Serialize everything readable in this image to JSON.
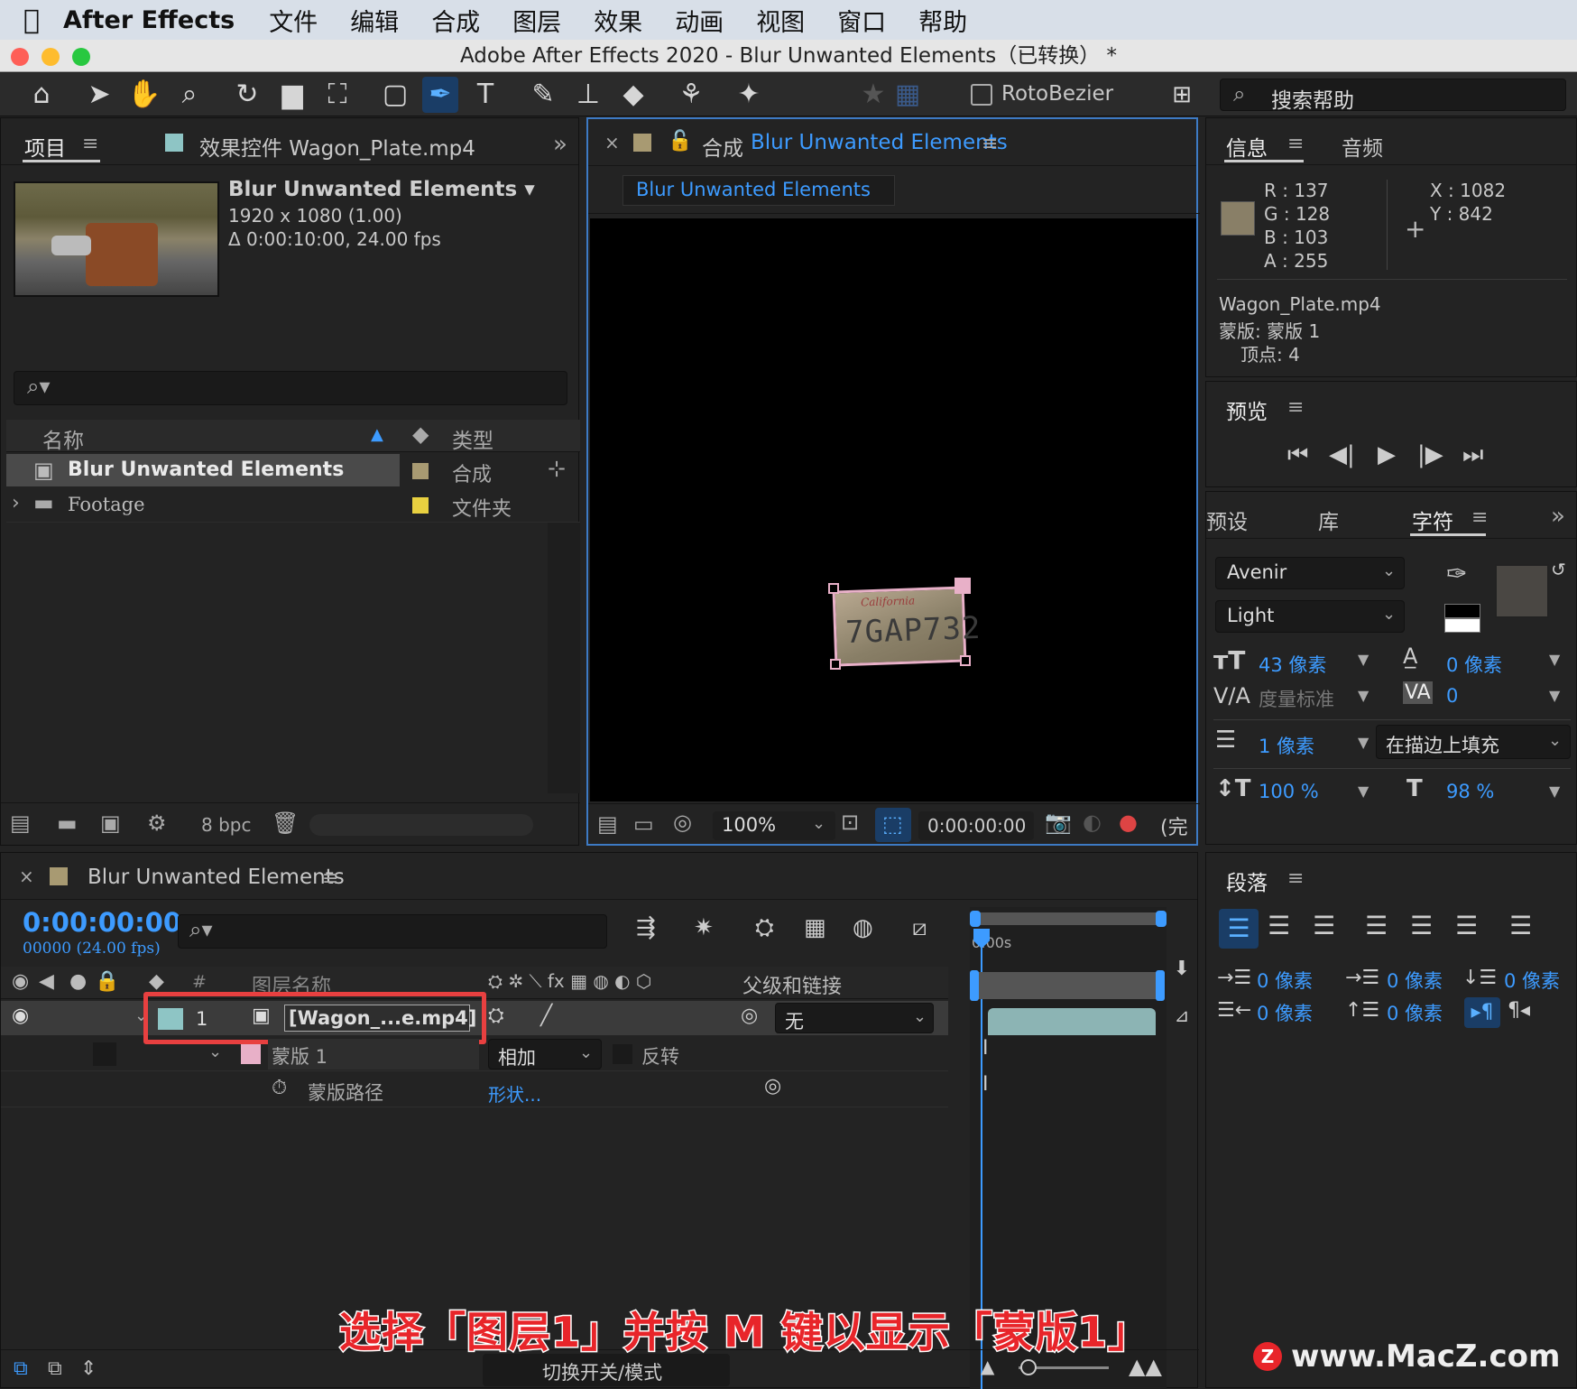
{
  "menubar": {
    "app_name": "After Effects",
    "items": [
      "文件",
      "编辑",
      "合成",
      "图层",
      "效果",
      "动画",
      "视图",
      "窗口",
      "帮助"
    ]
  },
  "window": {
    "title": "Adobe After Effects 2020 - Blur Unwanted Elements（已转换） *"
  },
  "toolbar": {
    "roto_label": "RotoBezier",
    "search_help": "搜索帮助"
  },
  "project_panel": {
    "tab_project": "项目",
    "tab_effects": "效果控件 Wagon_Plate.mp4",
    "comp_name": "Blur Unwanted Elements",
    "comp_size": "1920 x 1080 (1.00)",
    "comp_duration": "Δ 0:00:10:00, 24.00 fps",
    "col_name": "名称",
    "col_type": "类型",
    "items": [
      {
        "name": "Blur Unwanted Elements",
        "type": "合成",
        "color": "#a89a72"
      },
      {
        "name": "Footage",
        "type": "文件夹",
        "color": "#e8d040"
      }
    ],
    "bpc": "8 bpc"
  },
  "comp_panel": {
    "tab_prefix": "合成",
    "tab_name": "Blur Unwanted Elements",
    "subtab": "Blur Unwanted Elements",
    "zoom": "100%",
    "timecode": "0:00:00:00",
    "quality_fragment": "(完",
    "plate_text": "7GAP732",
    "plate_state": "California"
  },
  "info_panel": {
    "tab_info": "信息",
    "tab_audio": "音频",
    "r": "R :  137",
    "g": "G :  128",
    "b": "B :  103",
    "a": "A :  255",
    "x": "X :  1082",
    "y": "Y :  842",
    "swatch": "#897f67",
    "file": "Wagon_Plate.mp4",
    "mask": "蒙版: 蒙版 1",
    "vertices": "顶点: 4"
  },
  "preview_panel": {
    "title": "预览"
  },
  "char_panel": {
    "tab_presets": "预设",
    "tab_library": "库",
    "tab_char": "字符",
    "font": "Avenir",
    "style": "Light",
    "size": "43 像素",
    "leading": "0 像素",
    "kerning": "度量标准",
    "tracking": "0",
    "stroke": "1 像素",
    "stroke_mode": "在描边上填充",
    "vscale": "100 %",
    "hscale": "98 %"
  },
  "paragraph_panel": {
    "title": "段落",
    "indent_left": "0 像素",
    "indent_first": "0 像素",
    "space_before": "0 像素",
    "indent_right": "0 像素",
    "space_after": "0 像素"
  },
  "timeline": {
    "tab_name": "Blur Unwanted Elements",
    "timecode": "0:00:00:00",
    "frames": "00000 (24.00 fps)",
    "col_layer_name": "图层名称",
    "col_parent": "父级和链接",
    "col_hash": "#",
    "ruler_label": "0:00s",
    "layer": {
      "num": "1",
      "name": "[Wagon_...e.mp4]",
      "parent": "无"
    },
    "mask": {
      "name": "蒙版 1",
      "mode": "相加",
      "invert": "反转"
    },
    "mask_path": {
      "label": "蒙版路径",
      "value": "形状..."
    },
    "footer": "切换开关/模式"
  },
  "caption": "选择「图层1」并按 M 键以显示「蒙版1」",
  "watermark": "www.MacZ.com",
  "colors": {
    "accent": "#3d9bff",
    "highlight_red": "#e84040",
    "caption_red": "#e8252a",
    "layer_label": "#8ec5c5",
    "mask_label": "#e8b0c8"
  }
}
